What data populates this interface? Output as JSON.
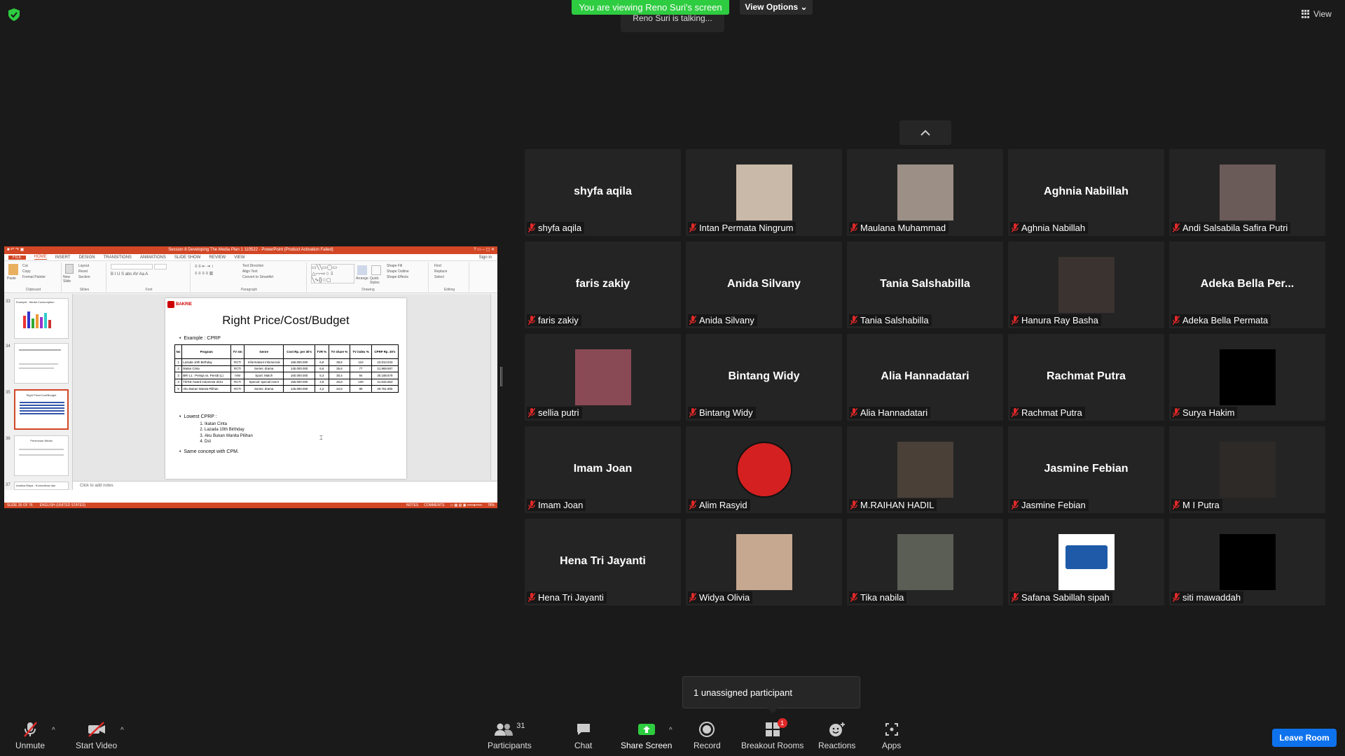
{
  "top": {
    "viewing_banner": "You are viewing Reno Suri's screen",
    "view_options": "View Options",
    "talking": "Reno Suri is talking...",
    "view_label": "View"
  },
  "share": {
    "window_title": "Session 8 Developing The Media Plan 1 110522 - PowerPoint (Product Activation Failed)",
    "tabs": [
      "FILE",
      "HOME",
      "INSERT",
      "DESIGN",
      "TRANSITIONS",
      "ANIMATIONS",
      "SLIDE SHOW",
      "REVIEW",
      "VIEW"
    ],
    "sign_in": "Sign in",
    "ribbon_groups": [
      "Clipboard",
      "Slides",
      "Font",
      "Paragraph",
      "Drawing",
      "Editing"
    ],
    "ribbon_items": {
      "paste": "Paste",
      "cut": "Cut",
      "copy": "Copy",
      "format_painter": "Format Painter",
      "new_slide": "New Slide",
      "layout": "Layout",
      "reset": "Reset",
      "section": "Section",
      "text_direction": "Text Direction",
      "align_text": "Align Text",
      "convert_smartart": "Convert to SmartArt",
      "arrange": "Arrange",
      "quick_styles": "Quick Styles",
      "shape_fill": "Shape Fill",
      "shape_outline": "Shape Outline",
      "shape_effects": "Shape Effects",
      "find": "Find",
      "replace": "Replace",
      "select": "Select"
    },
    "thumbs": [
      {
        "num": "33",
        "title": "Example : Media Consumption"
      },
      {
        "num": "34",
        "title": ""
      },
      {
        "num": "35",
        "title": "Right Price/Cost/Budget"
      },
      {
        "num": "36",
        "title": "Penerusan Media"
      },
      {
        "num": "37",
        "title": "Analisa Biaya - Komunikasi dan"
      }
    ],
    "slide": {
      "logo": "BAKRIE",
      "title": "Right Price/Cost/Budget",
      "example": "Example : CPRP",
      "headers": [
        "No",
        "Program",
        "TV stn",
        "Genre",
        "Cost Rp. per 30's",
        "TVR %",
        "TV share %",
        "TV index %",
        "CPRP Rp. 30's"
      ],
      "rows": [
        [
          "1",
          "Lazada 10th Birthday",
          "RCTI",
          "Information/ infomercial",
          "165.000.000",
          "6,9",
          "38,5",
          "110",
          "23.913.043"
        ],
        [
          "2",
          "Ikatan Cinta",
          "RCTI",
          "Series: drama",
          "145.000.000",
          "6,6",
          "35,6",
          "77",
          "21.969.697"
        ],
        [
          "3",
          "BRI L1 : Persija vs. Persib (L)",
          "IVM",
          "Sport: Match",
          "160.000.000",
          "5,3",
          "30,4",
          "94",
          "30.188.679"
        ],
        [
          "4",
          "TikTok Award Indonesia 2021",
          "RCTI",
          "Special: special event",
          "155.000.000",
          "4,9",
          "26,8",
          "100",
          "31.632.653"
        ],
        [
          "5",
          "Aku Bukan Wanita Pilihan",
          "RCTI",
          "Series: drama",
          "125.000.000",
          "4,2",
          "22,5",
          "89",
          "29.761.905"
        ]
      ],
      "lowest": "Lowest CPRP :",
      "list": [
        "Ikatan Cinta",
        "Lazada 10th Birthday",
        "Aku Bukan Wanita Pilihan",
        "Dst"
      ],
      "same": "Same concept with CPM."
    },
    "notes": "Click to add notes",
    "status": {
      "slide": "SLIDE 35 OF 76",
      "lang": "ENGLISH (UNITED STATES)",
      "notes": "NOTES",
      "comments": "COMMENTS",
      "zoom": "78%"
    }
  },
  "participants": [
    {
      "display": "shyfa aqila",
      "label": "shyfa aqila",
      "photo": false
    },
    {
      "display": "",
      "label": "Intan Permata Ningrum",
      "photo": true,
      "photo_color": "#c9b9a8"
    },
    {
      "display": "",
      "label": "Maulana Muhammad",
      "photo": true,
      "photo_color": "#9c8f86"
    },
    {
      "display": "Aghnia Nabillah",
      "label": "Aghnia Nabillah",
      "photo": false
    },
    {
      "display": "",
      "label": "Andi Salsabila Safira Putri",
      "photo": true,
      "photo_color": "#6a5a58"
    },
    {
      "display": "faris zakiy",
      "label": "faris zakiy",
      "photo": false
    },
    {
      "display": "Anida Silvany",
      "label": "Anida Silvany",
      "photo": false
    },
    {
      "display": "Tania Salshabilla",
      "label": "Tania Salshabilla",
      "photo": false
    },
    {
      "display": "",
      "label": "Hanura Ray Basha",
      "photo": true,
      "photo_color": "#3a3330"
    },
    {
      "display": "Adeka Bella Per...",
      "label": "Adeka Bella Permata",
      "photo": false
    },
    {
      "display": "",
      "label": "sellia putri",
      "photo": true,
      "photo_color": "#8a4a55"
    },
    {
      "display": "Bintang Widy",
      "label": "Bintang Widy",
      "photo": false
    },
    {
      "display": "Alia Hannadatari",
      "label": "Alia Hannadatari",
      "photo": false
    },
    {
      "display": "Rachmat Putra",
      "label": "Rachmat Putra",
      "photo": false
    },
    {
      "display": "",
      "label": "Surya Hakim",
      "photo": true,
      "photo_color": "#000000"
    },
    {
      "display": "Imam Joan",
      "label": "Imam Joan",
      "photo": false
    },
    {
      "display": "",
      "label": "Alim Rasyid",
      "photo": true,
      "photo_color": "#d42020"
    },
    {
      "display": "",
      "label": "M.RAIHAN HADIL",
      "photo": true,
      "photo_color": "#4a4038"
    },
    {
      "display": "Jasmine Febian",
      "label": "Jasmine Febian",
      "photo": false
    },
    {
      "display": "",
      "label": "M I Putra",
      "photo": true,
      "photo_color": "#2e2a28"
    },
    {
      "display": "Hena Tri Jayanti",
      "label": "Hena Tri Jayanti",
      "photo": false
    },
    {
      "display": "",
      "label": "Widya Olivia",
      "photo": true,
      "photo_color": "#c6a890"
    },
    {
      "display": "",
      "label": "Tika nabila",
      "photo": true,
      "photo_color": "#5a5e55"
    },
    {
      "display": "",
      "label": "Safana Sabillah sipah",
      "photo": true,
      "photo_color": "#ffffff"
    },
    {
      "display": "",
      "label": "siti mawaddah",
      "photo": true,
      "photo_color": "#000000"
    }
  ],
  "tooltip": {
    "unassigned": "1 unassigned participant"
  },
  "toolbar": {
    "unmute": "Unmute",
    "start_video": "Start Video",
    "participants": "Participants",
    "participants_count": "31",
    "chat": "Chat",
    "share_screen": "Share Screen",
    "record": "Record",
    "breakout": "Breakout Rooms",
    "breakout_badge": "1",
    "reactions": "Reactions",
    "apps": "Apps",
    "leave": "Leave Room"
  },
  "colors": {
    "share_green": "#2ecc40",
    "leave_blue": "#0e72ed",
    "ppt_red": "#d24726",
    "muted_red": "#e02828"
  }
}
